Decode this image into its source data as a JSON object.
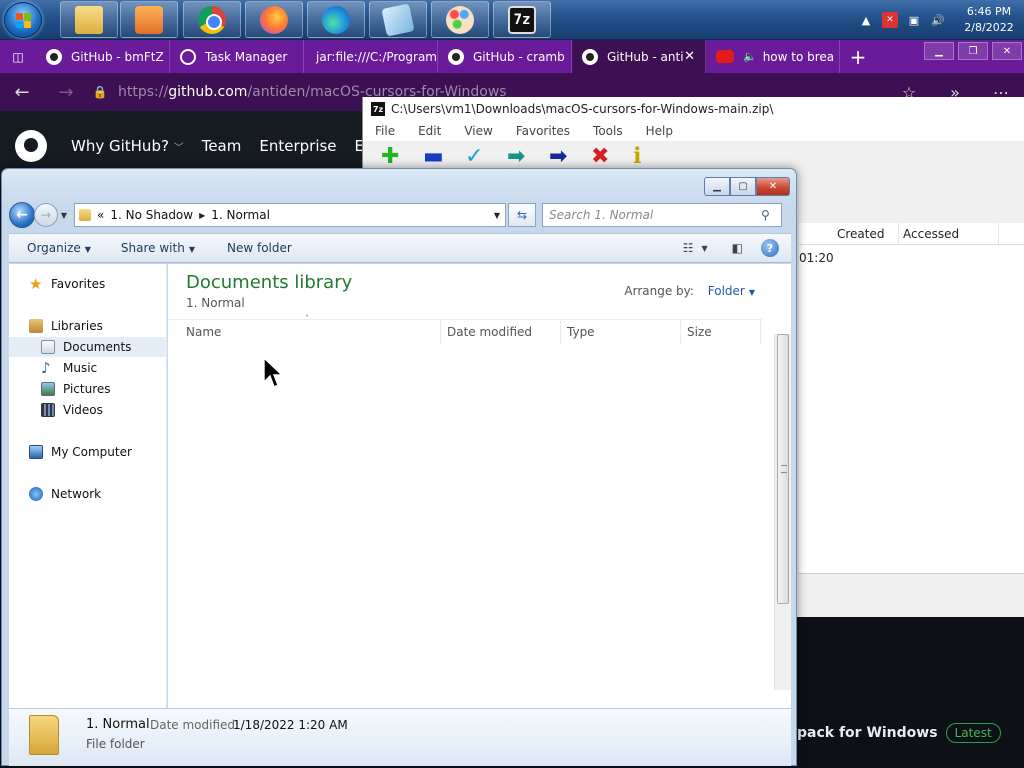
{
  "taskbar": {
    "pinned": [
      {
        "name": "file-explorer-icon",
        "label": ""
      },
      {
        "name": "media-player-icon",
        "label": ""
      },
      {
        "name": "chrome-icon",
        "label": ""
      },
      {
        "name": "firefox-icon",
        "label": ""
      },
      {
        "name": "edge-icon",
        "label": ""
      },
      {
        "name": "notepad-icon",
        "label": ""
      },
      {
        "name": "paint-icon",
        "label": ""
      },
      {
        "name": "7zip-icon",
        "label": "7z"
      }
    ],
    "clock": {
      "time": "6:46 PM",
      "date": "2/8/2022"
    }
  },
  "browser": {
    "tabs": [
      {
        "label": "GitHub - bmFtZ",
        "icon": "github-icon",
        "active": false
      },
      {
        "label": "Task Manager",
        "icon": "task-manager-icon",
        "active": false
      },
      {
        "label": "jar:file:///C:/Program",
        "icon": "",
        "active": false
      },
      {
        "label": "GitHub - cramb",
        "icon": "github-icon",
        "active": false
      },
      {
        "label": "GitHub - anti",
        "icon": "github-icon",
        "active": true
      },
      {
        "label": "how to brea",
        "icon": "youtube-icon",
        "active": false
      }
    ],
    "url_prefix": "https://",
    "url_host": "github.com",
    "url_path": "/antiden/macOS-cursors-for-Windows",
    "page": {
      "nav": [
        "Why GitHub?",
        "Team",
        "Enterprise",
        "Exp"
      ],
      "release_title": "pack for Windows",
      "release_badge": "Latest"
    }
  },
  "zip": {
    "title": "C:\\Users\\vm1\\Downloads\\macOS-cursors-for-Windows-main.zip\\",
    "menu": [
      "File",
      "Edit",
      "View",
      "Favorites",
      "Tools",
      "Help"
    ],
    "toolbar_icons": [
      "add-icon",
      "extract-minus-icon",
      "test-check-icon",
      "copy-arrow-icon",
      "move-arrow-icon",
      "delete-x-icon",
      "info-icon"
    ],
    "columns": [
      "Created",
      "Accessed"
    ],
    "row_cell": "01:20",
    "colors": {
      "add": "#1fb81f",
      "minus": "#1a3cc4",
      "check": "#16a4c8",
      "copy": "#16958a",
      "move": "#142a99",
      "delete": "#d42020",
      "info": "#e0c000"
    }
  },
  "explorer": {
    "breadcrumb": [
      "1. No Shadow",
      "1. Normal"
    ],
    "breadcrumb_overflow": "«",
    "search_placeholder": "Search 1. Normal",
    "commands": {
      "organize": "Organize",
      "share": "Share with",
      "new_folder": "New folder"
    },
    "nav_pane": {
      "favorites": "Favorites",
      "libraries": "Libraries",
      "library_items": [
        "Documents",
        "Music",
        "Pictures",
        "Videos"
      ],
      "computer": "My Computer",
      "network": "Network"
    },
    "library": {
      "title": "Documents library",
      "subtitle": "1. Normal",
      "arrange_label": "Arrange by:",
      "arrange_value": "Folder"
    },
    "columns": [
      "Name",
      "Date modified",
      "Type",
      "Size"
    ],
    "details": {
      "name": "1. Normal",
      "modified_label": "Date modified:",
      "modified_value": "1/18/2022 1:20 AM",
      "type": "File folder"
    }
  }
}
